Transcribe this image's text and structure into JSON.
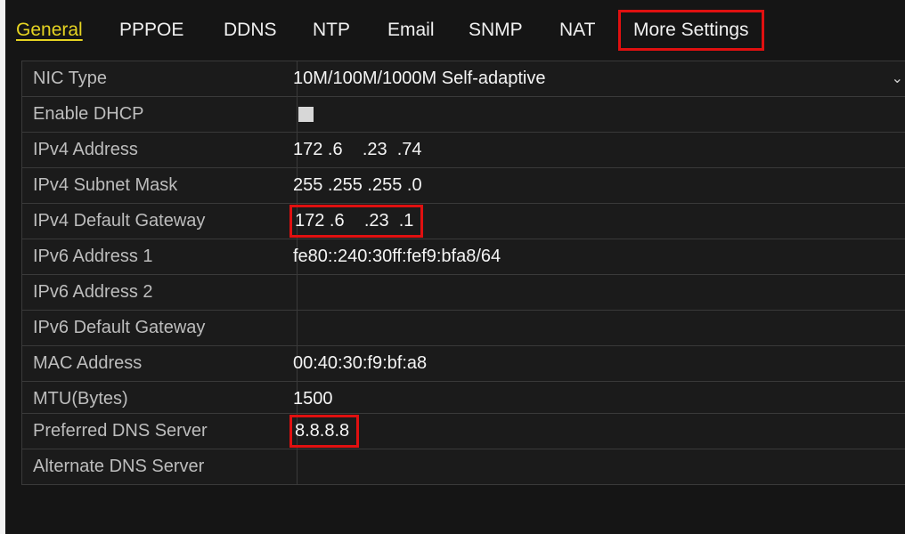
{
  "tabs": [
    "General",
    "PPPOE",
    "DDNS",
    "NTP",
    "Email",
    "SNMP",
    "NAT",
    "More Settings"
  ],
  "settings": {
    "nic_type": {
      "label": "NIC Type",
      "value": "10M/100M/1000M Self-adaptive"
    },
    "enable_dhcp": {
      "label": "Enable DHCP",
      "checked": false
    },
    "ipv4_address": {
      "label": "IPv4 Address",
      "value": "172 .6    .23  .74"
    },
    "ipv4_subnet_mask": {
      "label": "IPv4 Subnet Mask",
      "value": "255 .255 .255 .0"
    },
    "ipv4_default_gateway": {
      "label": "IPv4 Default Gateway",
      "value": "172 .6    .23  .1"
    },
    "ipv6_address_1": {
      "label": "IPv6 Address 1",
      "value": "fe80::240:30ff:fef9:bfa8/64"
    },
    "ipv6_address_2": {
      "label": "IPv6 Address 2",
      "value": ""
    },
    "ipv6_default_gateway": {
      "label": "IPv6 Default Gateway",
      "value": ""
    },
    "mac_address": {
      "label": "MAC Address",
      "value": "00:40:30:f9:bf:a8"
    },
    "mtu": {
      "label": "MTU(Bytes)",
      "value": "1500"
    }
  },
  "dns": {
    "preferred": {
      "label": "Preferred DNS Server",
      "value": "8.8.8.8"
    },
    "alternate": {
      "label": "Alternate DNS Server",
      "value": ""
    }
  },
  "colors": {
    "active_tab": "#e6d422",
    "highlight_box": "#e01010",
    "panel_bg": "#151515"
  }
}
